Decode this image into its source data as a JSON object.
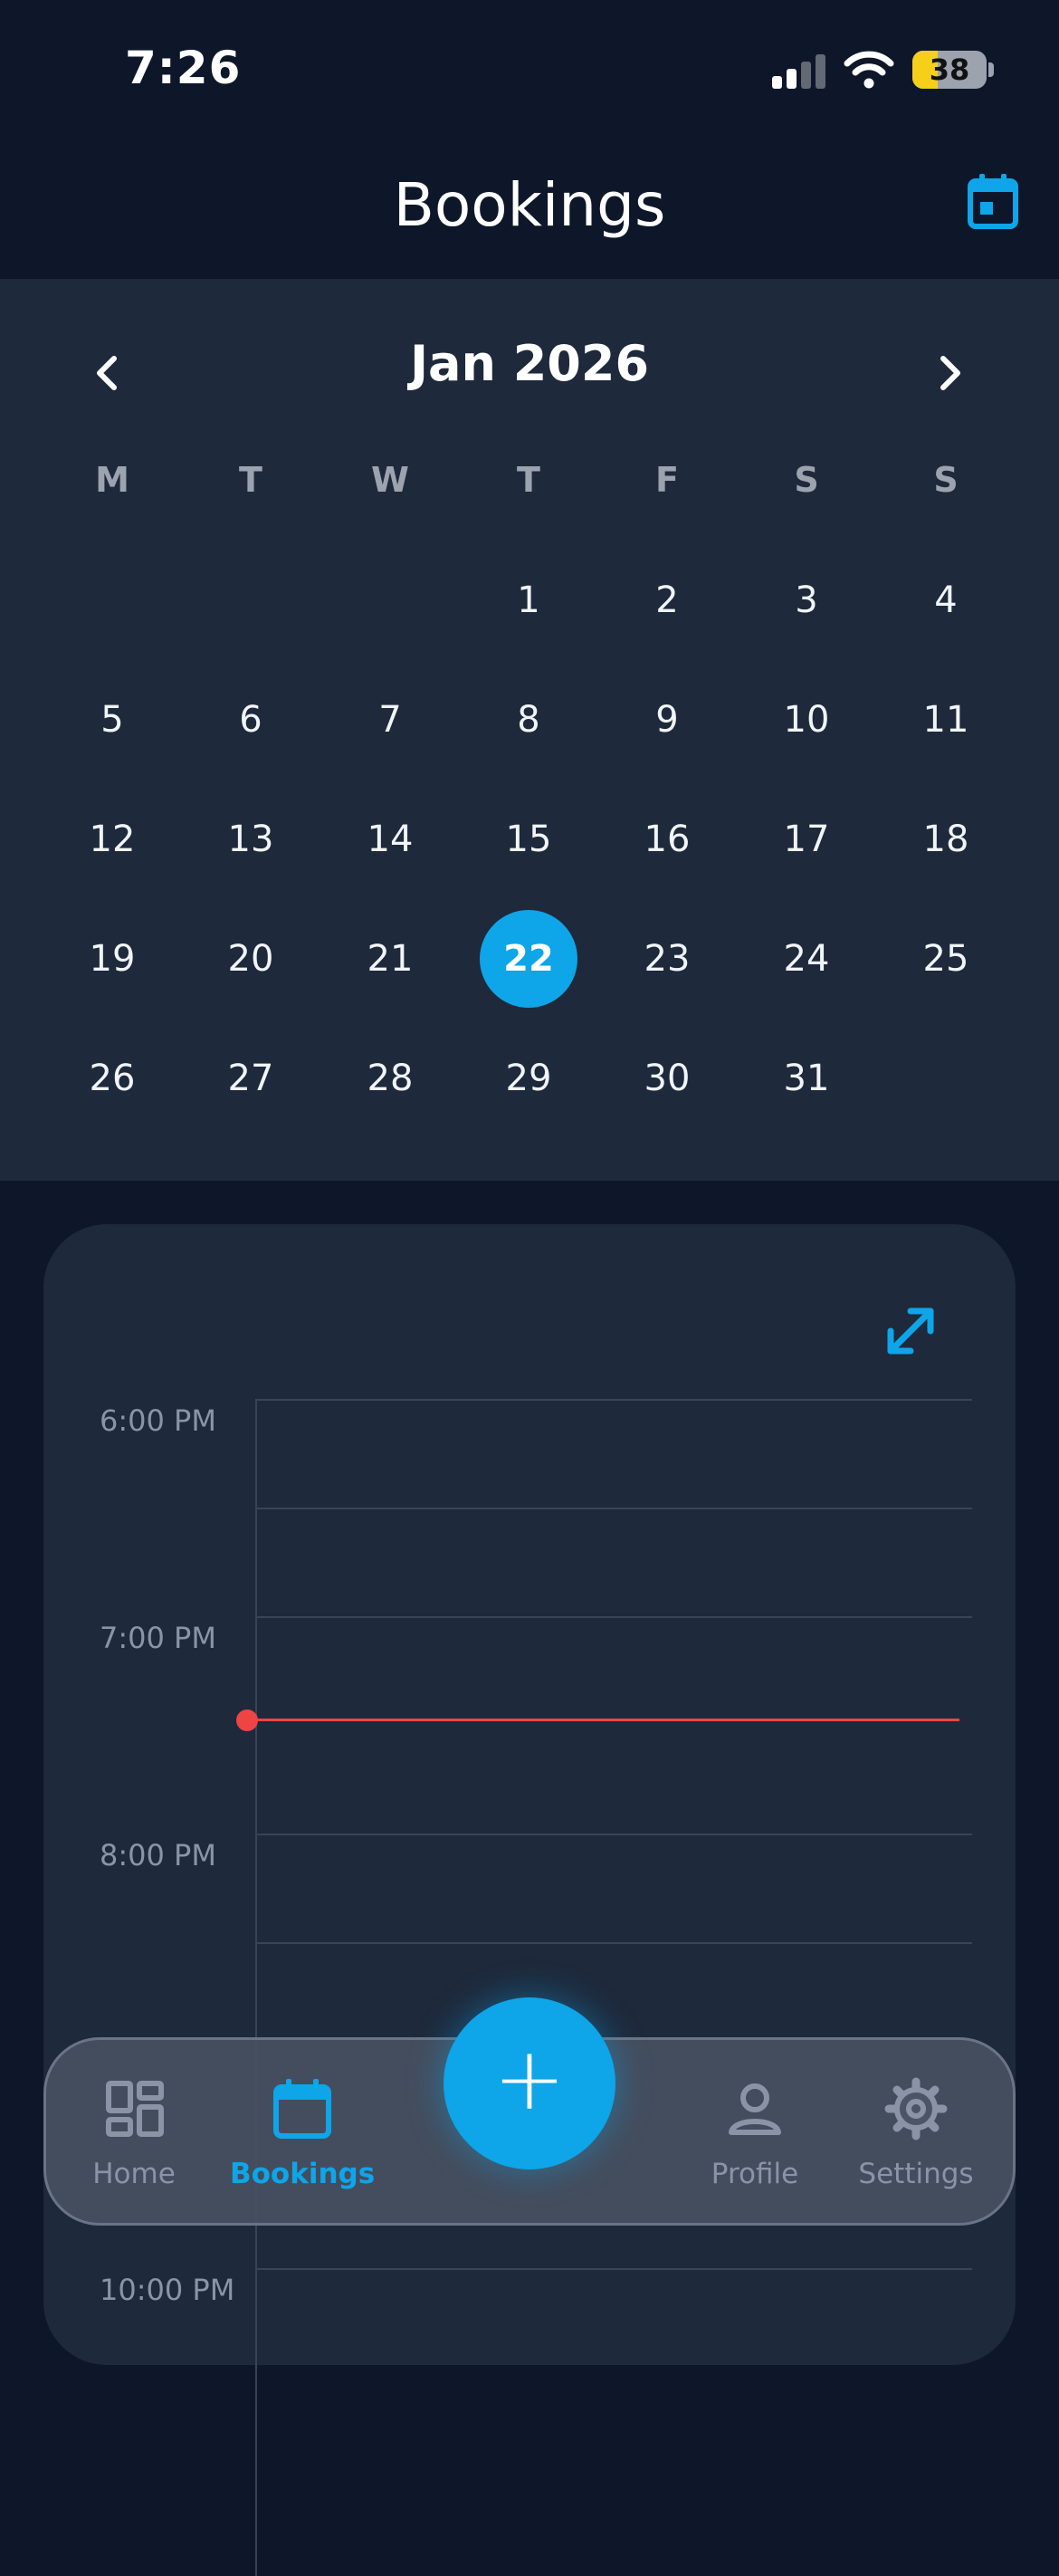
{
  "status_bar": {
    "time": "7:26",
    "battery": "38"
  },
  "header": {
    "title": "Bookings",
    "calendar_icon": "calendar-icon"
  },
  "calendar": {
    "month_label": "Jan 2026",
    "weekdays": [
      "M",
      "T",
      "W",
      "T",
      "F",
      "S",
      "S"
    ],
    "weeks": [
      [
        "",
        "",
        "",
        "1",
        "2",
        "3",
        "4"
      ],
      [
        "5",
        "6",
        "7",
        "8",
        "9",
        "10",
        "11"
      ],
      [
        "12",
        "13",
        "14",
        "15",
        "16",
        "17",
        "18"
      ],
      [
        "19",
        "20",
        "21",
        "22",
        "23",
        "24",
        "25"
      ],
      [
        "26",
        "27",
        "28",
        "29",
        "30",
        "31",
        ""
      ]
    ],
    "selected_day": "22"
  },
  "schedule": {
    "time_labels": [
      "6:00 PM",
      "7:00 PM",
      "8:00 PM",
      "10:00 PM"
    ],
    "now_indicator_color": "#ef4444"
  },
  "tab_bar": {
    "tabs": [
      {
        "label": "Home",
        "icon": "grid-icon"
      },
      {
        "label": "Bookings",
        "icon": "calendar-icon",
        "active": true
      },
      {
        "label": "Profile",
        "icon": "person-icon"
      },
      {
        "label": "Settings",
        "icon": "gear-icon"
      }
    ],
    "fab_label": "+"
  },
  "colors": {
    "accent": "#0ea5e9",
    "background": "#0e172a",
    "surface": "#1e293b",
    "muted": "#8a94a6",
    "now_line": "#ef4444"
  }
}
